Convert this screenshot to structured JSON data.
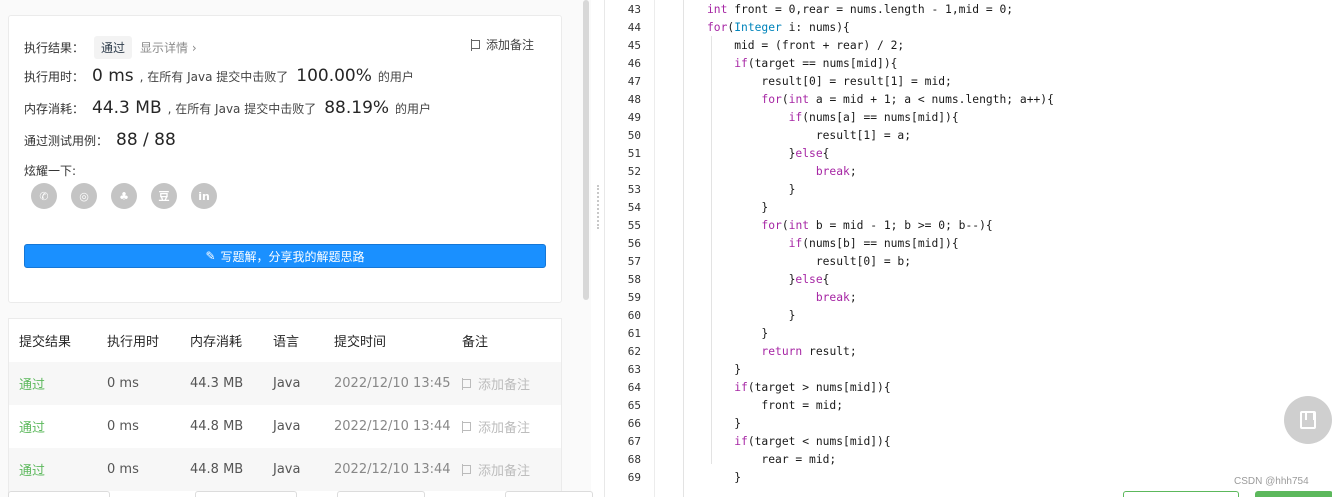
{
  "result": {
    "status_label": "执行结果：",
    "status_badge": "通过",
    "detail_link": "显示详情 ›",
    "add_note": "添加备注",
    "runtime_label": "执行用时：",
    "runtime_value": "0 ms",
    "runtime_mid": ", 在所有 Java 提交中击败了",
    "runtime_pct": "100.00%",
    "runtime_tail": "的用户",
    "memory_label": "内存消耗：",
    "memory_value": "44.3 MB",
    "memory_mid": ", 在所有 Java 提交中击败了",
    "memory_pct": "88.19%",
    "memory_tail": "的用户",
    "cases_label": "通过测试用例：",
    "cases_value": "88 / 88",
    "share_label": "炫耀一下:",
    "share_icons": [
      "wechat-icon",
      "weibo-icon",
      "qq-icon",
      "douban-icon",
      "linkedin-icon"
    ],
    "share_glyphs": [
      "✆",
      "◎",
      "♣",
      "豆",
      "in"
    ],
    "write_button": "写题解，分享我的解题思路"
  },
  "history": {
    "headers": [
      "提交结果",
      "执行用时",
      "内存消耗",
      "语言",
      "提交时间",
      "备注"
    ],
    "rows": [
      {
        "status": "通过",
        "time": "0 ms",
        "memory": "44.3 MB",
        "lang": "Java",
        "submitted": "2022/12/10 13:45",
        "note": "添加备注"
      },
      {
        "status": "通过",
        "time": "0 ms",
        "memory": "44.8 MB",
        "lang": "Java",
        "submitted": "2022/12/10 13:44",
        "note": "添加备注"
      },
      {
        "status": "通过",
        "time": "0 ms",
        "memory": "44.8 MB",
        "lang": "Java",
        "submitted": "2022/12/10 13:44",
        "note": "添加备注"
      }
    ]
  },
  "editor": {
    "line_numbers": [
      "43",
      "44",
      "45",
      "46",
      "47",
      "48",
      "49",
      "50",
      "51",
      "52",
      "53",
      "54",
      "55",
      "56",
      "57",
      "58",
      "59",
      "60",
      "61",
      "62",
      "63",
      "64",
      "65",
      "66",
      "67",
      "68",
      "69"
    ],
    "lines": [
      "int front = 0,rear = nums.length - 1,mid = 0;",
      "for(Integer i: nums){",
      "    mid = (front + rear) / 2;",
      "    if(target == nums[mid]){",
      "        result[0] = result[1] = mid;",
      "        for(int a = mid + 1; a < nums.length; a++){",
      "            if(nums[a] == nums[mid]){",
      "                result[1] = a;",
      "            }else{",
      "                break;",
      "            }",
      "        }",
      "        for(int b = mid - 1; b >= 0; b--){",
      "            if(nums[b] == nums[mid]){",
      "                result[0] = b;",
      "            }else{",
      "                break;",
      "            }",
      "        }",
      "        return result;",
      "    }",
      "    if(target > nums[mid]){",
      "        front = mid;",
      "    }",
      "    if(target < nums[mid]){",
      "        rear = mid;",
      "    }"
    ]
  },
  "watermark": "CSDN @hhh754",
  "colors": {
    "pass": "#5cb85c",
    "primary": "#1a90ff",
    "keyword": "#a626a4",
    "type": "#0184bb"
  }
}
